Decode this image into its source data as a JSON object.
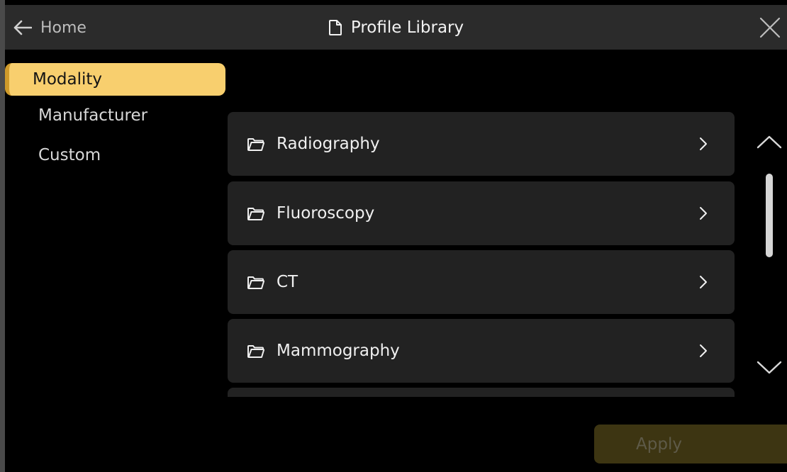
{
  "header": {
    "back_label": "Home",
    "title": "Profile Library",
    "back_icon": "arrow-left-icon",
    "title_icon": "document-icon",
    "close_icon": "close-icon"
  },
  "sidebar": {
    "items": [
      {
        "label": "Modality",
        "active": true
      },
      {
        "label": "Manufacturer",
        "active": false
      },
      {
        "label": "Custom",
        "active": false
      }
    ]
  },
  "list": {
    "items": [
      {
        "label": "Radiography",
        "icon": "folder-icon"
      },
      {
        "label": "Fluoroscopy",
        "icon": "folder-icon"
      },
      {
        "label": "CT",
        "icon": "folder-icon"
      },
      {
        "label": "Mammography",
        "icon": "folder-icon"
      }
    ],
    "scroll_up_icon": "chevron-up-icon",
    "scroll_down_icon": "chevron-down-icon"
  },
  "footer": {
    "apply_label": "Apply",
    "apply_enabled": false
  },
  "colors": {
    "accent": "#f8cf6e",
    "accent_border": "#cf9a2a",
    "row_bg": "#222222",
    "titlebar_bg": "#2b2b2b",
    "apply_disabled_bg": "#3d3512"
  }
}
